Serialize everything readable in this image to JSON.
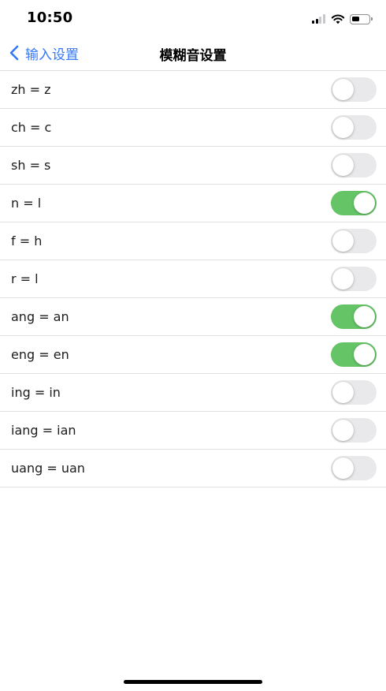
{
  "status_bar": {
    "time": "10:50",
    "icons": [
      "cellular-signal-icon",
      "wifi-icon",
      "battery-icon"
    ],
    "battery_level": 0.45
  },
  "nav": {
    "back_label": "输入设置",
    "title": "模糊音设置",
    "back_icon": "chevron-left-icon",
    "accent_color": "#3478f6"
  },
  "settings": [
    {
      "label": "zh = z",
      "enabled": false
    },
    {
      "label": "ch = c",
      "enabled": false
    },
    {
      "label": "sh = s",
      "enabled": false
    },
    {
      "label": "n = l",
      "enabled": true
    },
    {
      "label": "f = h",
      "enabled": false
    },
    {
      "label": "r = l",
      "enabled": false
    },
    {
      "label": "ang = an",
      "enabled": true
    },
    {
      "label": "eng = en",
      "enabled": true
    },
    {
      "label": "ing = in",
      "enabled": false
    },
    {
      "label": "iang = ian",
      "enabled": false
    },
    {
      "label": "uang = uan",
      "enabled": false
    }
  ],
  "colors": {
    "toggle_on": "#65c466",
    "toggle_off": "#e9e9eb"
  }
}
